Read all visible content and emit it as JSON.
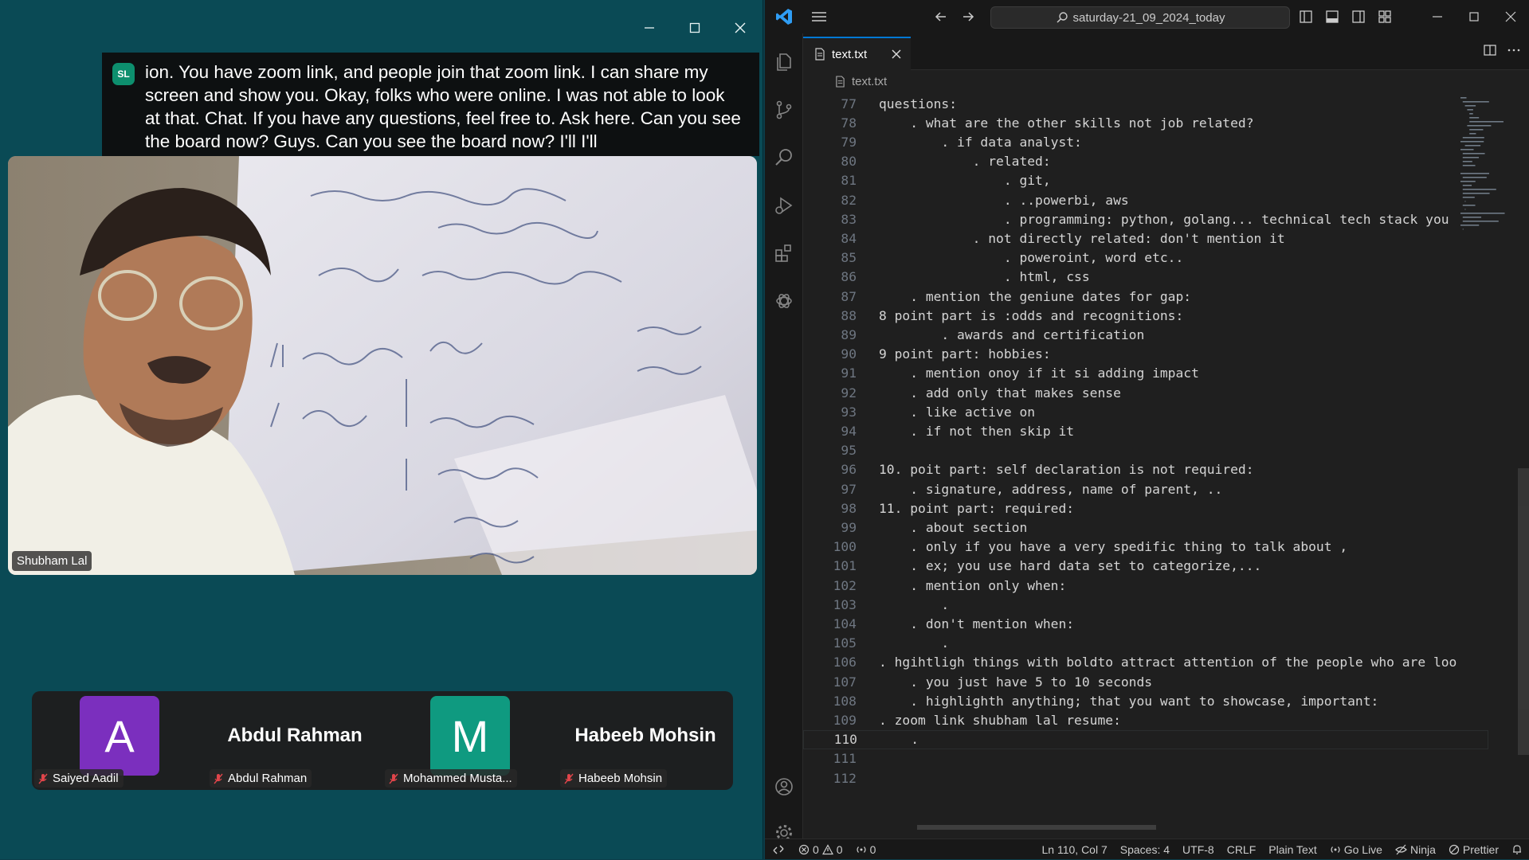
{
  "zoom": {
    "caption": {
      "initials": "SL",
      "text": "ion. You have zoom link, and people join that zoom link. I can share my screen and show you. Okay, folks who were online. I was not able to look at that. Chat. If you have any questions, feel free to. Ask here. Can you see the board now? Guys. Can you see the board now? I'll I'll"
    },
    "speaker_name": "Shubham Lal",
    "participants": [
      {
        "kind": "avatar",
        "letter": "A",
        "color": "#7b2fbe",
        "label": "Saiyed Aadil"
      },
      {
        "kind": "name",
        "display": "Abdul Rahman",
        "label": "Abdul Rahman"
      },
      {
        "kind": "avatar",
        "letter": "M",
        "color": "#0f9a80",
        "label": "Mohammed Musta..."
      },
      {
        "kind": "name",
        "display": "Habeeb Mohsin",
        "label": "Habeeb Mohsin"
      }
    ]
  },
  "vscode": {
    "search_text": "saturday-21_09_2024_today",
    "tab_label": "text.txt",
    "breadcrumb": "text.txt",
    "lines": [
      {
        "n": "77",
        "t": "questions:"
      },
      {
        "n": "78",
        "t": "    . what are the other skills not job related?"
      },
      {
        "n": "79",
        "t": "        . if data analyst:"
      },
      {
        "n": "80",
        "t": "            . related:"
      },
      {
        "n": "81",
        "t": "                . git,"
      },
      {
        "n": "82",
        "t": "                . ..powerbi, aws"
      },
      {
        "n": "83",
        "t": "                . programming: python, golang... technical tech stack you"
      },
      {
        "n": "84",
        "t": "            . not directly related: don't mention it"
      },
      {
        "n": "85",
        "t": "                . poweroint, word etc.."
      },
      {
        "n": "86",
        "t": "                . html, css"
      },
      {
        "n": "87",
        "t": "    . mention the geniune dates for gap:"
      },
      {
        "n": "88",
        "t": "8 point part is :odds and recognitions:"
      },
      {
        "n": "89",
        "t": "        . awards and certification"
      },
      {
        "n": "90",
        "t": "9 point part: hobbies:"
      },
      {
        "n": "91",
        "t": "    . mention onoy if it si adding impact"
      },
      {
        "n": "92",
        "t": "    . add only that makes sense"
      },
      {
        "n": "93",
        "t": "    . like active on"
      },
      {
        "n": "94",
        "t": "    . if not then skip it"
      },
      {
        "n": "95",
        "t": ""
      },
      {
        "n": "96",
        "t": "10. poit part: self declaration is not required:"
      },
      {
        "n": "97",
        "t": "    . signature, address, name of parent, .."
      },
      {
        "n": "98",
        "t": "11. point part: required:"
      },
      {
        "n": "99",
        "t": "    . about section"
      },
      {
        "n": "100",
        "t": "    . only if you have a very spedific thing to talk about ,"
      },
      {
        "n": "101",
        "t": "    . ex; you use hard data set to categorize,..."
      },
      {
        "n": "102",
        "t": "    . mention only when:"
      },
      {
        "n": "103",
        "t": "        ."
      },
      {
        "n": "104",
        "t": "    . don't mention when:"
      },
      {
        "n": "105",
        "t": "        ."
      },
      {
        "n": "106",
        "t": ". hgihtligh things with boldto attract attention of the people who are loo"
      },
      {
        "n": "107",
        "t": "    . you just have 5 to 10 seconds"
      },
      {
        "n": "108",
        "t": "    . highlighth anything; that you want to showcase, important:"
      },
      {
        "n": "109",
        "t": ". zoom link shubham lal resume:"
      },
      {
        "n": "110",
        "t": "    .",
        "active": true
      },
      {
        "n": "111",
        "t": ""
      },
      {
        "n": "112",
        "t": ""
      }
    ],
    "status": {
      "errors": "0",
      "warnings": "0",
      "ports": "0",
      "position": "Ln 110, Col 7",
      "spaces": "Spaces: 4",
      "encoding": "UTF-8",
      "eol": "CRLF",
      "language": "Plain Text",
      "golive": "Go Live",
      "ninja": "Ninja",
      "prettier": "Prettier"
    }
  }
}
